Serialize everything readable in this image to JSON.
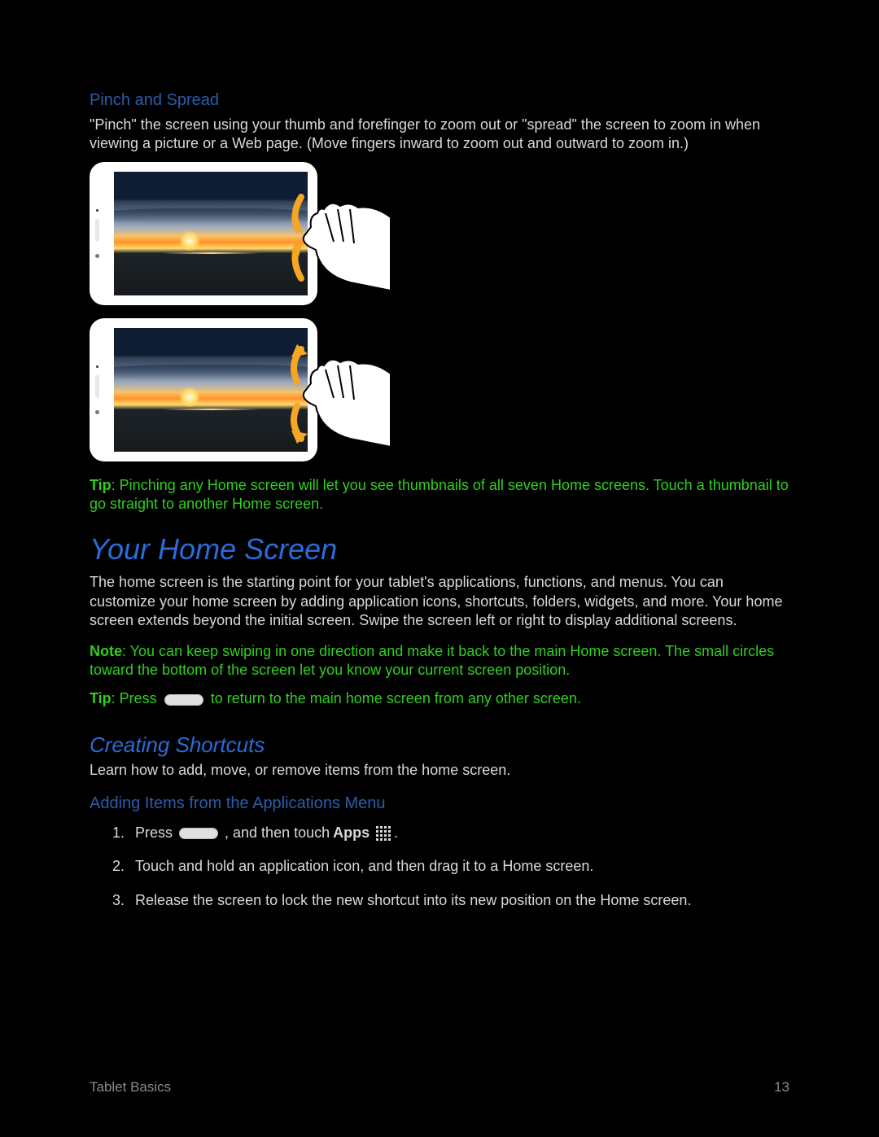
{
  "section1": {
    "heading": "Pinch and Spread",
    "body": "\"Pinch\" the screen using your thumb and forefinger to zoom out or \"spread\" the screen to zoom in when viewing a picture or a Web page. (Move fingers inward to zoom out and outward to zoom in.)"
  },
  "tip1": {
    "label": "Tip",
    "text": ": Pinching any Home screen will let you see thumbnails of all seven Home screens. Touch a thumbnail to go straight to another Home screen."
  },
  "section2": {
    "heading": "Your Home Screen",
    "body": "The home screen is the starting point for your tablet's applications, functions, and menus. You can customize your home screen by adding application icons, shortcuts, folders, widgets, and more. Your home screen extends beyond the initial screen. Swipe the screen left or right to display additional screens."
  },
  "note2": {
    "label": "Note",
    "text": ": You can keep swiping in one direction and make it back to the main Home screen. The small circles toward the bottom of the screen let you know your current screen position."
  },
  "tip2": {
    "label": "Tip",
    "prefix": ": Press ",
    "suffix": " to return to the main home screen from any other screen."
  },
  "section3": {
    "heading": "Creating Shortcuts",
    "body": "Learn how to add, move, or remove items from the home screen."
  },
  "section4": {
    "heading": "Adding Items from the Applications Menu"
  },
  "steps": {
    "s1": {
      "num": "1.",
      "p1": "Press ",
      "p2": ", and then touch ",
      "p3": "Apps "
    },
    "s2": {
      "num": "2.",
      "text": "Touch and hold an application icon, and then drag it to a Home screen."
    },
    "s3": {
      "num": "3.",
      "text": "Release the screen to lock the new shortcut into its new position on the Home screen."
    }
  },
  "footer": {
    "left": "Tablet Basics",
    "right": "13"
  }
}
